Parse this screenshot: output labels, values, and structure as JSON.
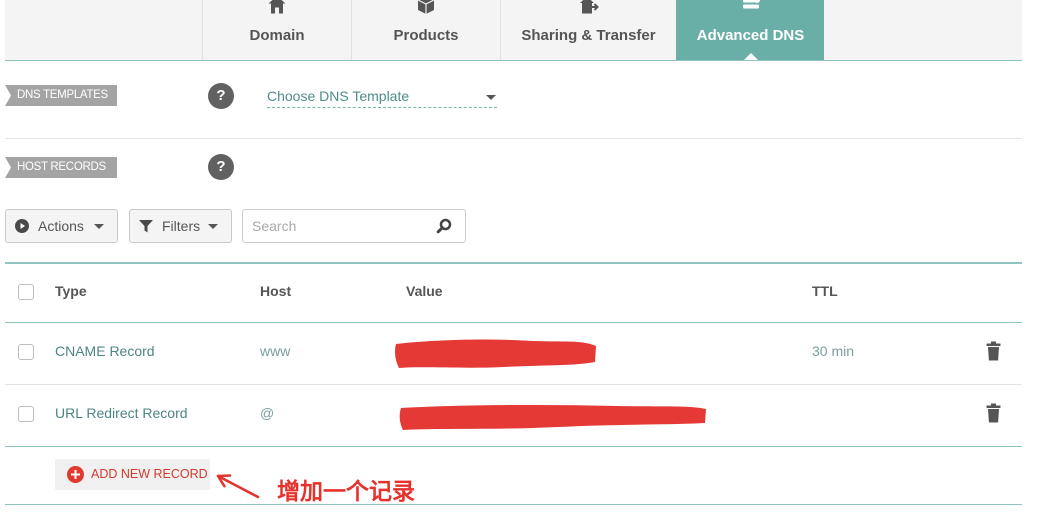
{
  "tabs": [
    {
      "label": "Domain",
      "icon": "home-icon",
      "active": false
    },
    {
      "label": "Products",
      "icon": "box-icon",
      "active": false
    },
    {
      "label": "Sharing & Transfer",
      "icon": "share-icon",
      "active": false
    },
    {
      "label": "Advanced DNS",
      "icon": "dns-icon",
      "active": true
    }
  ],
  "dns_templates": {
    "label": "DNS TEMPLATES",
    "help": "?",
    "selected": "Choose DNS Template"
  },
  "host_records": {
    "label": "HOST RECORDS",
    "help": "?",
    "toolbar": {
      "actions": "Actions",
      "actions_icon": "play-circle-icon",
      "filters": "Filters",
      "filters_icon": "funnel-icon",
      "search_placeholder": "Search",
      "search_icon": "search-icon"
    },
    "columns": {
      "type": "Type",
      "host": "Host",
      "value": "Value",
      "ttl": "TTL"
    },
    "rows": [
      {
        "type": "CNAME Record",
        "host": "www",
        "value_redacted": true,
        "ttl": "30 min",
        "delete_icon": "trash-icon"
      },
      {
        "type": "URL Redirect Record",
        "host": "@",
        "value_redacted": true,
        "ttl": "",
        "delete_icon": "trash-icon"
      }
    ],
    "add_record": "ADD NEW RECORD"
  },
  "annotation": {
    "text": "增加一个记录"
  },
  "colors": {
    "accent": "#6aaea8",
    "section_tag": "#a4a4a4",
    "add_record": "#d23a2f",
    "annotation": "#e5322d"
  }
}
